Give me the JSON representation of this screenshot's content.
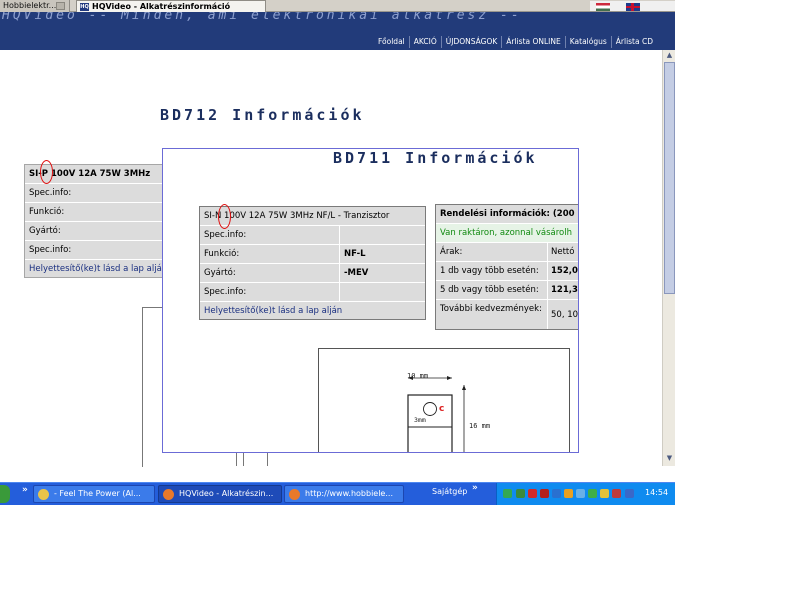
{
  "browser": {
    "tabs": [
      {
        "label": "Hobbielektr..."
      },
      {
        "label": "HQVideo - Alkatrészinformáció",
        "favicon": "HQ"
      }
    ]
  },
  "header": {
    "tagline": "HQVideo -- Minden, ami elektronikai alkatrész --",
    "nav": [
      "Főoldal",
      "AKCIÓ",
      "ÚJDONSÁGOK",
      "Árlista ONLINE",
      "Katalógus",
      "Árlista CD"
    ]
  },
  "bd712": {
    "title": "BD712 Információk",
    "head": "SI-P 100V 12A 75W 3MHz",
    "rows": [
      "Spec.info:",
      "Funkció:",
      "Gyártó:",
      "Spec.info:"
    ],
    "link": "Helyettesítő(ke)t lásd a lap alján"
  },
  "bd711": {
    "title": "BD711 Információk",
    "spec": {
      "head": "SI-N 100V 12A 75W 3MHz NF/L - Tranzisztor",
      "rows": [
        {
          "k": "Spec.info:",
          "v": ""
        },
        {
          "k": "Funkció:",
          "v": "NF-L"
        },
        {
          "k": "Gyártó:",
          "v": "-MEV"
        },
        {
          "k": "Spec.info:",
          "v": ""
        }
      ],
      "link": "Helyettesítő(ke)t lásd a lap alján"
    },
    "order": {
      "head": "Rendelési információk: (200",
      "stock": "Van raktáron, azonnal vásárolh",
      "price_label": "Árak:",
      "price_col": "Nettó",
      "rows": [
        {
          "k": "1 db vagy több esetén:",
          "v": "152,0"
        },
        {
          "k": "5 db vagy több esetén:",
          "v": "121,3"
        }
      ],
      "discount_label": "További kedvezmények:",
      "discount_value": "50, 10"
    },
    "diagram": {
      "width_label": "10 mm",
      "height_label": "16 mm",
      "hole_label": "3mm",
      "pin_label": "c"
    }
  },
  "taskbar": {
    "tasks": [
      {
        "label": "- Feel The Power (Al..."
      },
      {
        "label": "HQVideo - Alkatrészin..."
      },
      {
        "label": "http://www.hobbiele..."
      }
    ],
    "toolbar": "Sajátgép",
    "clock": "14:54"
  }
}
